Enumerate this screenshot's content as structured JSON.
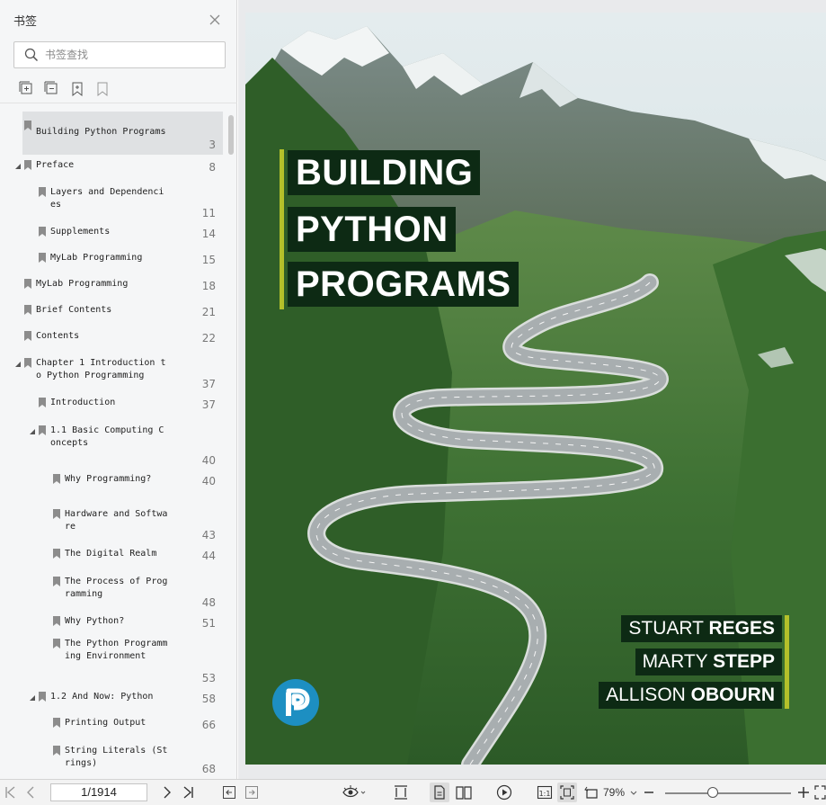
{
  "sidebar": {
    "title": "书签",
    "search_placeholder": "书签查找",
    "bookmarks": [
      {
        "label": "Building Python Programs",
        "page": "3",
        "selected": true
      },
      {
        "label": "Preface",
        "page": "8",
        "expanded": true
      },
      {
        "label": "Layers and Dependenci\nes",
        "page": "11"
      },
      {
        "label": "Supplements",
        "page": "14"
      },
      {
        "label": "MyLab Programming",
        "page": "15"
      },
      {
        "label": "MyLab Programming",
        "page": "18"
      },
      {
        "label": "Brief Contents",
        "page": "21"
      },
      {
        "label": "Contents",
        "page": "22"
      },
      {
        "label": "Chapter 1 Introduction t\no Python Programming",
        "page": "37",
        "expanded": true
      },
      {
        "label": "Introduction",
        "page": "37"
      },
      {
        "label": "1.1 Basic Computing C\noncepts",
        "page": "40",
        "expanded": true
      },
      {
        "label": "Why Programming?",
        "page": "40"
      },
      {
        "label": "Hardware and Softwa\nre",
        "page": "43"
      },
      {
        "label": "The Digital Realm",
        "page": "44"
      },
      {
        "label": "The Process of Prog\nramming",
        "page": "48"
      },
      {
        "label": "Why Python?",
        "page": "51"
      },
      {
        "label": "The Python Programm\ning Environment",
        "page": "53"
      },
      {
        "label": "1.2 And Now: Python",
        "page": "58",
        "expanded": true
      },
      {
        "label": "Printing Output",
        "page": "66"
      },
      {
        "label": "String Literals (St\nrings)",
        "page": "68"
      }
    ]
  },
  "cover": {
    "title_lines": [
      "BUILDING",
      "PYTHON",
      "PROGRAMS"
    ],
    "authors": [
      {
        "first": "STUART ",
        "last": "REGES"
      },
      {
        "first": "MARTY ",
        "last": "STEPP"
      },
      {
        "first": "ALLISON ",
        "last": "OBOURN"
      }
    ],
    "publisher_logo": "pearson-logo",
    "colors": {
      "title_bg": "#0d2a14",
      "accent_bar": "#b4c02a",
      "logo_blue": "#1d8fc2"
    }
  },
  "statusbar": {
    "page_indicator": "1/1914",
    "zoom": "79%"
  }
}
